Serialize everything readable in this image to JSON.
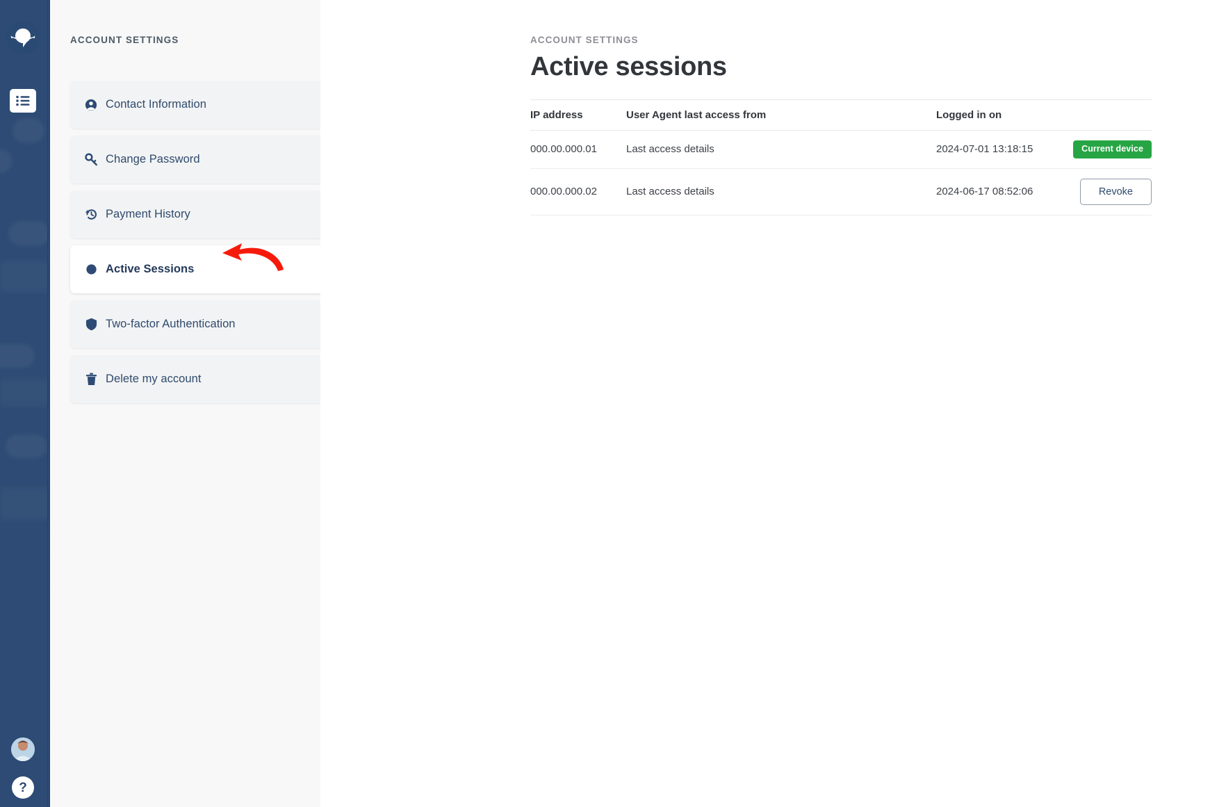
{
  "rail": {
    "logo_icon": "planet-logo-icon",
    "nav_icon": "list-menu-icon",
    "avatar_icon": "user-avatar",
    "help_label": "?",
    "help_icon": "help-question-icon",
    "background_color": "#2d4b74"
  },
  "settings_menu": {
    "kicker": "ACCOUNT SETTINGS",
    "items": [
      {
        "label": "Contact Information",
        "icon": "user-circle-icon",
        "active": false
      },
      {
        "label": "Change Password",
        "icon": "key-icon",
        "active": false
      },
      {
        "label": "Payment History",
        "icon": "history-icon",
        "active": false
      },
      {
        "label": "Active Sessions",
        "icon": "circle-dot-icon",
        "active": true
      },
      {
        "label": "Two-factor Authentication",
        "icon": "shield-icon",
        "active": false
      },
      {
        "label": "Delete my account",
        "icon": "trash-icon",
        "active": false
      }
    ]
  },
  "annotation": {
    "arrow_icon": "red-curved-arrow-icon",
    "color": "#f61a0b",
    "points_to": "Active Sessions"
  },
  "main": {
    "kicker": "ACCOUNT SETTINGS",
    "title": "Active sessions",
    "table": {
      "columns": [
        "IP address",
        "User Agent last access from",
        "Logged in on",
        ""
      ],
      "rows": [
        {
          "ip": "000.00.000.01",
          "agent": "Last access details",
          "logged_in_on": "2024-07-01 13:18:15",
          "action_type": "badge",
          "action_label": "Current device"
        },
        {
          "ip": "000.00.000.02",
          "agent": "Last access details",
          "logged_in_on": "2024-06-17 08:52:06",
          "action_type": "button",
          "action_label": "Revoke"
        }
      ]
    }
  },
  "colors": {
    "accent_navy": "#2d4b74",
    "success_green": "#27a544",
    "annotation_red": "#f61a0b",
    "menu_bg": "#f8f8f9",
    "card_bg": "#f2f3f4"
  }
}
